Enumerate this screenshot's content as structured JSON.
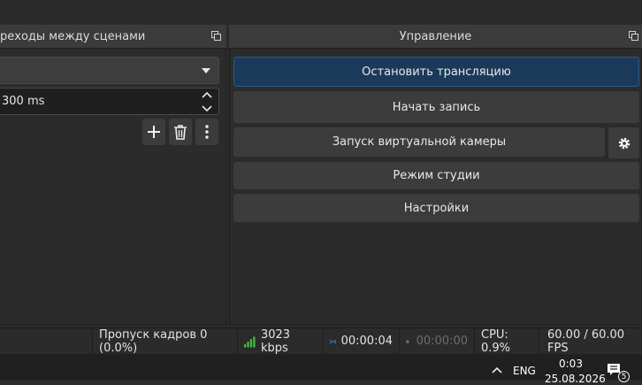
{
  "transitions": {
    "title": "реходы между сценами",
    "combo_value": "",
    "duration": "300 ms"
  },
  "controls": {
    "title": "Управление",
    "stop_stream": "Остановить трансляцию",
    "start_record": "Начать запись",
    "virtual_cam": "Запуск виртуальной камеры",
    "studio_mode": "Режим студии",
    "settings": "Настройки"
  },
  "status": {
    "dropped_frames": "Пропуск кадров 0 (0.0%)",
    "bitrate": "3023 kbps",
    "stream_time": "00:00:04",
    "record_time": "00:00:00",
    "cpu": "CPU: 0.9%",
    "fps": "60.00 / 60.00 FPS"
  },
  "taskbar": {
    "language": "ENG",
    "time": "0:03",
    "date": "25.08.2026",
    "notification_count": "5"
  },
  "colors": {
    "accent": "#1b3a5a",
    "signal_green": "#3ec43e",
    "live_blue": "#3b8df0"
  }
}
